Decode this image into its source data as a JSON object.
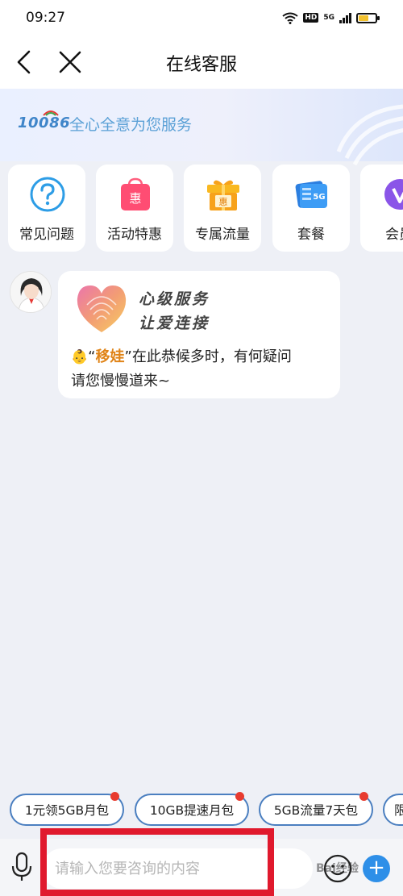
{
  "status_bar": {
    "time": "09:27",
    "hd": "HD",
    "network": "5G"
  },
  "nav": {
    "title": "在线客服"
  },
  "banner": {
    "logo": "10086",
    "slogan": "全心全意为您服务"
  },
  "quick_entries": [
    {
      "label": "常见问题",
      "icon": "question-icon"
    },
    {
      "label": "活动特惠",
      "icon": "shopping-bag-icon",
      "icon_text": "惠"
    },
    {
      "label": "专属流量",
      "icon": "gift-icon",
      "icon_text": "惠"
    },
    {
      "label": "套餐",
      "icon": "sim-card-icon",
      "icon_text": "5G"
    },
    {
      "label": "会员",
      "icon": "vip-icon"
    }
  ],
  "chat": {
    "slogan_line1": "心级服务",
    "slogan_line2": "让爱连接",
    "greeting_quote_open": "“",
    "greeting_name": "移娃",
    "greeting_rest": "”在此恭候多时，有何疑问",
    "greeting_line2": "请您慢慢道来~"
  },
  "suggestion_chips": [
    {
      "label": "1元领5GB月包"
    },
    {
      "label": "10GB提速月包"
    },
    {
      "label": "5GB流量7天包"
    },
    {
      "label": "限"
    }
  ],
  "input": {
    "placeholder": "请输入您要咨询的内容",
    "plus": "+"
  },
  "watermark": "Bai经验",
  "colors": {
    "accent": "#2e8fe8",
    "chip_border": "#4b7fc0",
    "badge_red": "#e83b2f",
    "highlight": "#e08418"
  }
}
